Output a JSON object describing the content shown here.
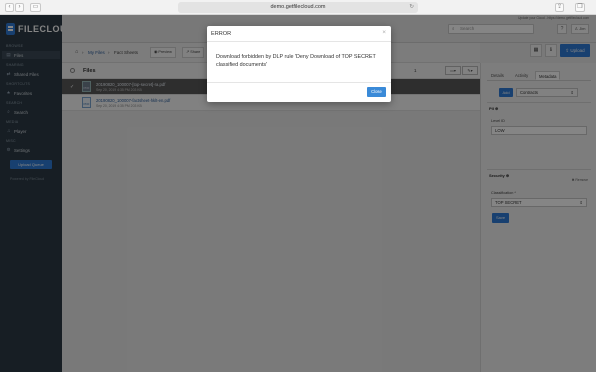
{
  "browser": {
    "url": "demo.getfilecloud.com",
    "back_glyph": "‹",
    "forward_glyph": "›",
    "sidebar_glyph": "▭",
    "reload_glyph": "↻",
    "share_glyph": "⇪",
    "tabs_glyph": "❐"
  },
  "app": {
    "logo_text": "FILECLOUD",
    "update_banner": "Update your Cloud - https://demo.getfilecloud.com",
    "search_placeholder": "Search",
    "user_label": "Jim",
    "help_label": "?"
  },
  "sidebar": {
    "sections": [
      {
        "label": "Browse"
      },
      {
        "label": "Sharing"
      },
      {
        "label": "Shortcuts"
      },
      {
        "label": "Search"
      },
      {
        "label": "Media"
      },
      {
        "label": "Misc"
      }
    ],
    "items": [
      {
        "label": "Files",
        "icon": "▤"
      },
      {
        "label": "Shared Files",
        "icon": "⇄"
      },
      {
        "label": "Favorites",
        "icon": "★"
      },
      {
        "label": "Search",
        "icon": "⌕"
      },
      {
        "label": "Player",
        "icon": "♫"
      },
      {
        "label": "Settings",
        "icon": "⚙"
      }
    ],
    "upload_queue": "Upload Queue",
    "powered_by": "Powered by FileCloud"
  },
  "breadcrumb": {
    "home_icon": "⌂",
    "items": [
      "My Files",
      "Fact Sheets"
    ],
    "separator": "›",
    "preview_label": "Preview",
    "share_label": "Share"
  },
  "toolbar": {
    "grid_glyph": "▦",
    "info_glyph": "ℹ",
    "upload_label": "Upload"
  },
  "filelist": {
    "title": "Files",
    "pager": "1",
    "rows": [
      {
        "name": "20190820_100007-[top-secret]-ra.pdf",
        "meta": "Sep 20, 2019 4:35 PM       203 KB"
      },
      {
        "name": "20190820_100007-factsheet-hklt-en.pdf",
        "meta": "Sep 20, 2019 4:35 PM       203 KB"
      }
    ]
  },
  "rightpanel": {
    "tabs": [
      "Details",
      "Activity",
      "Metadata"
    ],
    "add_label": "Add",
    "contracts_label": "Contracts",
    "pii_section": "PII ⊕",
    "level_label": "Level ID",
    "level_value": "LOW",
    "security_section": "Security ⊕",
    "remove_label": "✖ Remove",
    "classification_label": "Classification *",
    "classification_value": "TOP SECRET",
    "save_label": "Save"
  },
  "modal": {
    "title": "ERROR",
    "close_glyph": "×",
    "message": "Download forbidden by DLP rule 'Deny Download of TOP SECRET classified documents'",
    "close_label": "Close"
  },
  "colors": {
    "accent": "#2e7bd6",
    "sidebar_bg": "#2d3a45",
    "overlay": "rgba(0,0,0,0.48)"
  }
}
